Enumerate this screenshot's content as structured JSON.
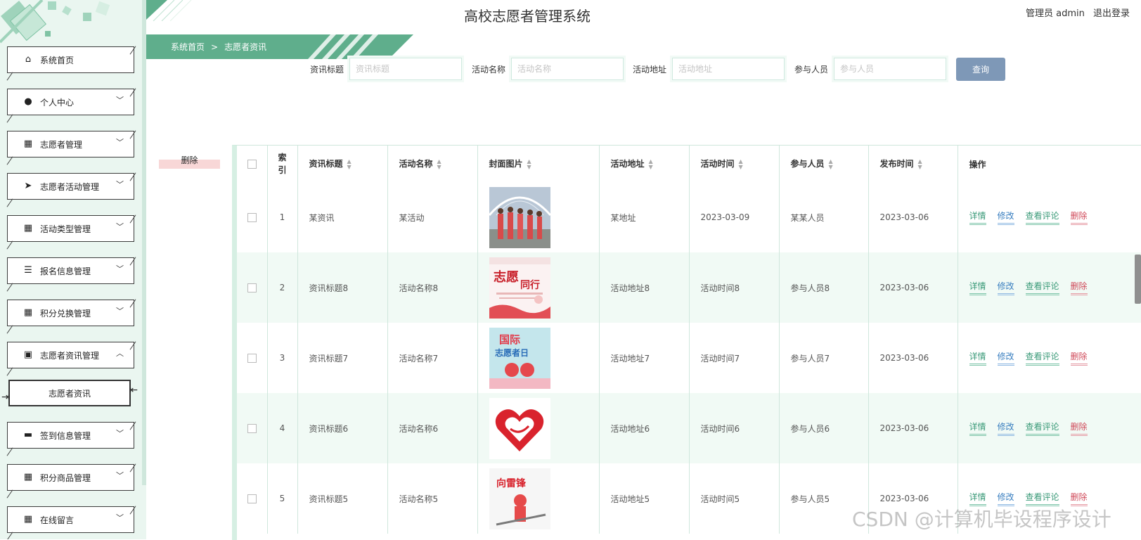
{
  "app": {
    "title": "高校志愿者管理系统"
  },
  "user": {
    "role_name": "管理员 admin",
    "logout_label": "退出登录"
  },
  "breadcrumb": {
    "home": "系统首页",
    "sep": ">",
    "current": "志愿者资讯"
  },
  "sidebar": {
    "items": [
      {
        "label": "系统首页",
        "icon": "home-icon",
        "glyph": "⌂",
        "expanded": false,
        "has_chevron": false
      },
      {
        "label": "个人中心",
        "icon": "user-icon",
        "glyph": "●",
        "expanded": false,
        "has_chevron": true
      },
      {
        "label": "志愿者管理",
        "icon": "grid-icon",
        "glyph": "▦",
        "expanded": false,
        "has_chevron": true
      },
      {
        "label": "志愿者活动管理",
        "icon": "paper-plane-icon",
        "glyph": "➤",
        "expanded": false,
        "has_chevron": true
      },
      {
        "label": "活动类型管理",
        "icon": "grid-icon",
        "glyph": "▦",
        "expanded": false,
        "has_chevron": true
      },
      {
        "label": "报名信息管理",
        "icon": "sliders-icon",
        "glyph": "☰",
        "expanded": false,
        "has_chevron": true
      },
      {
        "label": "积分兑换管理",
        "icon": "grid-9-icon",
        "glyph": "▦",
        "expanded": false,
        "has_chevron": true
      },
      {
        "label": "志愿者资讯管理",
        "icon": "clipboard-check-icon",
        "glyph": "▣",
        "expanded": true,
        "has_chevron": true
      },
      {
        "label": "签到信息管理",
        "icon": "briefcase-icon",
        "glyph": "▬",
        "expanded": false,
        "has_chevron": true
      },
      {
        "label": "积分商品管理",
        "icon": "grid-icon",
        "glyph": "▦",
        "expanded": false,
        "has_chevron": true
      },
      {
        "label": "在线留言",
        "icon": "grid-icon",
        "glyph": "▦",
        "expanded": false,
        "has_chevron": true
      }
    ],
    "submenu_active": "志愿者资讯",
    "chevron_down": "﹀",
    "chevron_up": "︿"
  },
  "search": {
    "fields": [
      {
        "label": "资讯标题",
        "placeholder": "资讯标题",
        "value": ""
      },
      {
        "label": "活动名称",
        "placeholder": "活动名称",
        "value": ""
      },
      {
        "label": "活动地址",
        "placeholder": "活动地址",
        "value": ""
      },
      {
        "label": "参与人员",
        "placeholder": "参与人员",
        "value": ""
      }
    ],
    "button_label": "查询"
  },
  "delete_button_label": "删除",
  "table": {
    "headers": {
      "index": "索引",
      "title": "资讯标题",
      "activity": "活动名称",
      "cover": "封面图片",
      "address": "活动地址",
      "activity_time": "活动时间",
      "participants": "参与人员",
      "publish_time": "发布时间",
      "actions": "操作"
    },
    "action_labels": {
      "detail": "详情",
      "edit": "修改",
      "comments": "查看评论",
      "delete": "删除"
    },
    "rows": [
      {
        "index": "1",
        "title": "某资讯",
        "activity": "某活动",
        "address": "某地址",
        "activity_time": "2023-03-09",
        "participants": "某某人员",
        "publish_time": "2023-03-06"
      },
      {
        "index": "2",
        "title": "资讯标题8",
        "activity": "活动名称8",
        "address": "活动地址8",
        "activity_time": "活动时间8",
        "participants": "参与人员8",
        "publish_time": "2023-03-06"
      },
      {
        "index": "3",
        "title": "资讯标题7",
        "activity": "活动名称7",
        "address": "活动地址7",
        "activity_time": "活动时间7",
        "participants": "参与人员7",
        "publish_time": "2023-03-06"
      },
      {
        "index": "4",
        "title": "资讯标题6",
        "activity": "活动名称6",
        "address": "活动地址6",
        "activity_time": "活动时间6",
        "participants": "参与人员6",
        "publish_time": "2023-03-06"
      },
      {
        "index": "5",
        "title": "资讯标题5",
        "activity": "活动名称5",
        "address": "活动地址5",
        "activity_time": "活动时间5",
        "participants": "参与人员5",
        "publish_time": "2023-03-06"
      }
    ]
  },
  "watermark": "CSDN @计算机毕设程序设计",
  "colors": {
    "theme_green": "#5fae8c",
    "search_button": "#7e98b7",
    "sidebar_bg": "#eaf6f0",
    "delete": "#d04a5a"
  }
}
